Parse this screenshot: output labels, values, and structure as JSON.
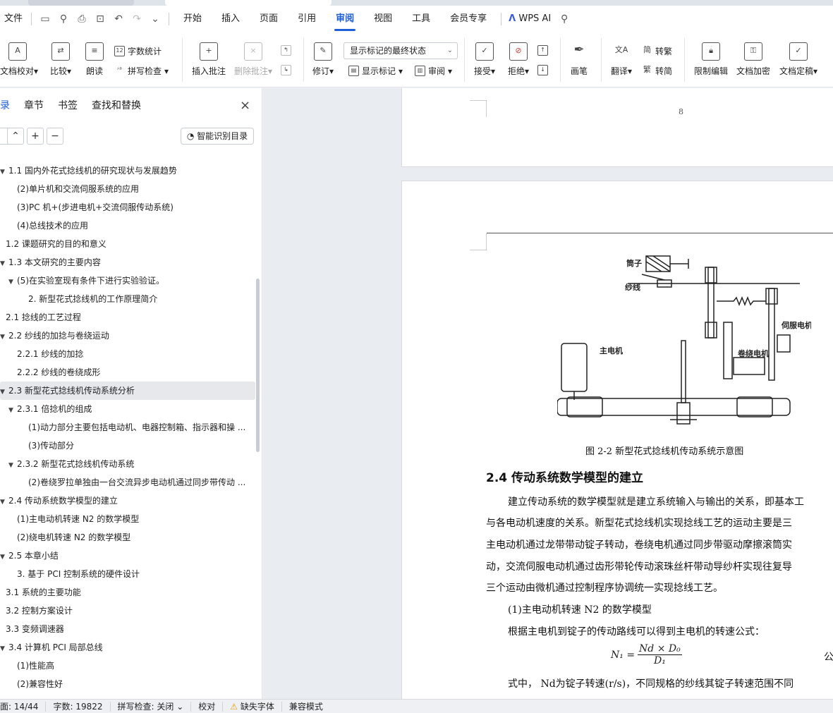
{
  "menubar": {
    "file": "文件",
    "tabs": [
      "开始",
      "插入",
      "页面",
      "引用",
      "审阅",
      "视图",
      "工具",
      "会员专享"
    ],
    "active_tab": "审阅",
    "wps_ai": "WPS AI"
  },
  "ribbon": {
    "doc_proof": "文档校对",
    "compare": "比较",
    "read_aloud": "朗读",
    "word_count": "字数统计",
    "spell_check": "拼写检查",
    "insert_comment": "插入批注",
    "delete_comment": "删除批注",
    "revise": "修订",
    "markup_state": "显示标记的最终状态",
    "show_markup": "显示标记",
    "review": "审阅",
    "accept": "接受",
    "reject": "拒绝",
    "pen": "画笔",
    "translate": "翻译",
    "to_traditional": "转繁",
    "to_simplified": "转简",
    "restrict_edit": "限制编辑",
    "encrypt": "文档加密",
    "finalize": "文档定稿"
  },
  "nav": {
    "tabs": [
      "录",
      "章节",
      "书签",
      "查找和替换"
    ],
    "smart_toc": "智能识别目录",
    "items": [
      {
        "level": 0,
        "arrow": true,
        "text": "1.1  国内外花式捻线机的研究现状与发展趋势"
      },
      {
        "level": 1,
        "arrow": false,
        "text": "(2)单片机和交流伺服系统的应用"
      },
      {
        "level": 1,
        "arrow": false,
        "text": "(3)PC 机+(步进电机+交流伺服传动系统)"
      },
      {
        "level": 1,
        "arrow": false,
        "text": "(4)总线技术的应用"
      },
      {
        "level": 0,
        "arrow": false,
        "text": "1.2  课题研究的目的和意义"
      },
      {
        "level": 0,
        "arrow": true,
        "text": "1.3  本文研究的主要内容"
      },
      {
        "level": 1,
        "arrow": true,
        "text": "(5)在实验室现有条件下进行实验验证。"
      },
      {
        "level": 2,
        "arrow": false,
        "text": "2. 新型花式捻线机的工作原理简介"
      },
      {
        "level": 0,
        "arrow": false,
        "text": "2.1  捻线的工艺过程"
      },
      {
        "level": 0,
        "arrow": true,
        "text": "2.2  纱线的加捻与卷绕运动"
      },
      {
        "level": 1,
        "arrow": false,
        "text": "2.2.1  纱线的加捻"
      },
      {
        "level": 1,
        "arrow": false,
        "text": "2.2.2  纱线的卷绕成形"
      },
      {
        "level": 0,
        "arrow": true,
        "text": "2.3  新型花式捻线机传动系统分析",
        "selected": true
      },
      {
        "level": 1,
        "arrow": true,
        "text": "2.3.1  倍捻机的组成"
      },
      {
        "level": 2,
        "arrow": false,
        "text": "(1)动力部分主要包括电动机、电器控制箱、指示器和操 ..."
      },
      {
        "level": 2,
        "arrow": false,
        "text": "(3)传动部分"
      },
      {
        "level": 1,
        "arrow": true,
        "text": "2.3.2  新型花式捻线机传动系统"
      },
      {
        "level": 2,
        "arrow": false,
        "text": "(2)卷绕罗拉单独由一台交流异步电动机通过同步带传动 ..."
      },
      {
        "level": 0,
        "arrow": true,
        "text": "2.4  传动系统数学模型的建立"
      },
      {
        "level": 1,
        "arrow": false,
        "text": "(1)主电动机转速 N2 的数学模型"
      },
      {
        "level": 1,
        "arrow": false,
        "text": "(2)绕电机转速 N2 的数学模型"
      },
      {
        "level": 0,
        "arrow": true,
        "text": "2.5  本章小结"
      },
      {
        "level": 1,
        "arrow": false,
        "text": "3. 基于 PCI 控制系统的硬件设计"
      },
      {
        "level": 0,
        "arrow": false,
        "text": "3.1  系统的主要功能"
      },
      {
        "level": 0,
        "arrow": false,
        "text": "3.2 控制方案设计"
      },
      {
        "level": 0,
        "arrow": false,
        "text": "3.3  变频调速器"
      },
      {
        "level": 0,
        "arrow": true,
        "text": "3.4  计算机 PCI 局部总线"
      },
      {
        "level": 1,
        "arrow": false,
        "text": "(1)性能高"
      },
      {
        "level": 1,
        "arrow": false,
        "text": "(2)兼容性好"
      }
    ]
  },
  "doc": {
    "page_number": "8",
    "figure_labels": {
      "tube": "筒子",
      "yarn": "纱线",
      "servo": "伺服电机",
      "main_motor": "主电机",
      "winding_motor": "卷绕电机"
    },
    "fig_caption": "图 2-2  新型花式捻线机传动系统示意图",
    "section_heading": "2.4  传动系统数学模型的建立",
    "paragraph_lines": [
      "建立传动系统的数学模型就是建立系统输入与输出的关系，即基本工",
      "与各电动机速度的关系。新型花式捻线机实现捻线工艺的运动主要是三",
      "主电动机通过龙带带动锭子转动，卷绕电机通过同步带驱动摩擦滚筒实",
      "动，交流伺服电动机通过齿形带轮传动滚珠丝杆带动导纱杆实现往复导",
      "三个运动由微机通过控制程序协调统一实现捻线工艺。"
    ],
    "sub_heading": "(1)主电动机转速 N2 的数学模型",
    "formula_intro": "根据主电机到锭子的传动路线可以得到主电机的转速公式：",
    "formula_lhs": "N₁ =",
    "formula_num": "Nd × D₀",
    "formula_den": "D₁",
    "formula_tag": "公",
    "formula_note": "式中，  Nd为锭子转速(r/s)，不同规格的纱线其锭子转速范围不同"
  },
  "statusbar": {
    "page": "面: 14/44",
    "words": "字数: 19822",
    "spell": "拼写检查: 关闭",
    "proof": "校对",
    "missing_font": "缺失字体",
    "compat": "兼容模式"
  }
}
